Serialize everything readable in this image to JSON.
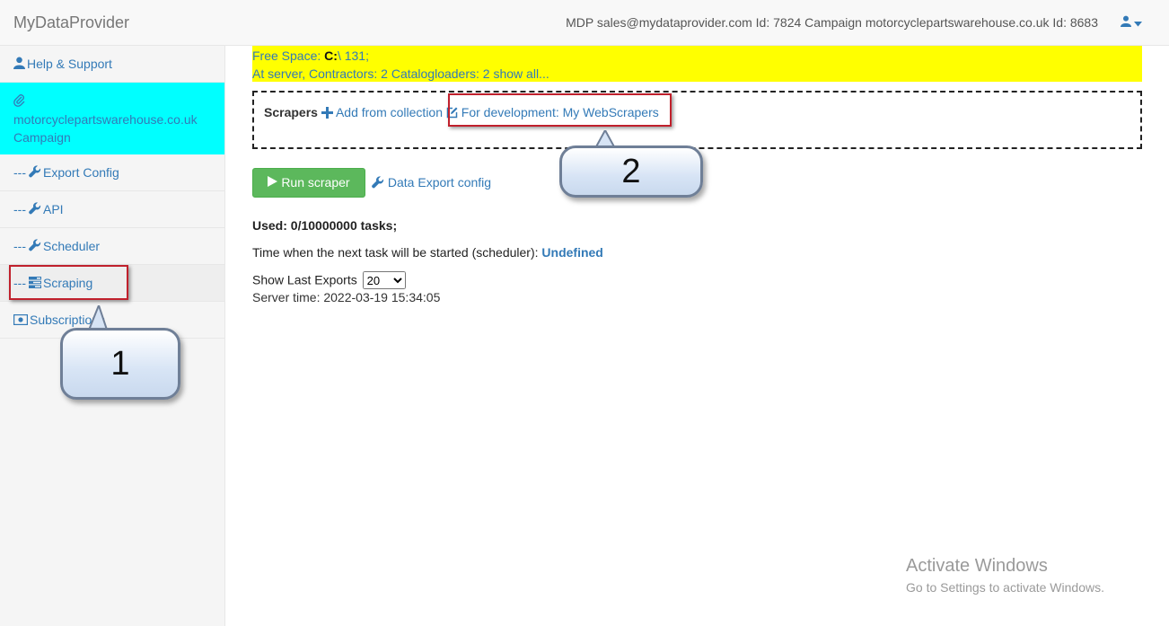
{
  "navbar": {
    "brand": "MyDataProvider",
    "info": "MDP sales@mydataprovider.com Id: 7824 Campaign motorcyclepartswarehouse.co.uk Id: 8683"
  },
  "sidebar": {
    "help": "Help & Support",
    "campaign_line1": "motorcyclepartswarehouse.co.uk",
    "campaign_line2": "Campaign",
    "dashes": "---",
    "export_config": "Export Config",
    "api": "API",
    "scheduler": "Scheduler",
    "scraping": "Scraping",
    "subscriptions": "Subscriptions"
  },
  "server_info": {
    "free_space_label": "Free Space:",
    "free_space_drive": "C:",
    "free_space_value": "\\ 131;",
    "contractors_text": "At server, Contractors: 2 Catalogloaders: 2",
    "show_all": "show all..."
  },
  "scrapers": {
    "label": "Scrapers",
    "add_from_collection": "Add from collection",
    "for_development": "For development: My WebScrapers"
  },
  "actions": {
    "run_scraper": "Run scraper",
    "data_export_config": "Data Export config"
  },
  "status": {
    "used": "Used: 0/10000000 tasks;",
    "next_task_label": "Time when the next task will be started (scheduler):",
    "next_task_value": "Undefined",
    "show_last_exports": "Show Last Exports",
    "exports_count": "20",
    "server_time": "Server time: 2022-03-19 15:34:05"
  },
  "callouts": {
    "one": "1",
    "two": "2"
  },
  "watermark": {
    "title": "Activate Windows",
    "subtitle": "Go to Settings to activate Windows."
  }
}
